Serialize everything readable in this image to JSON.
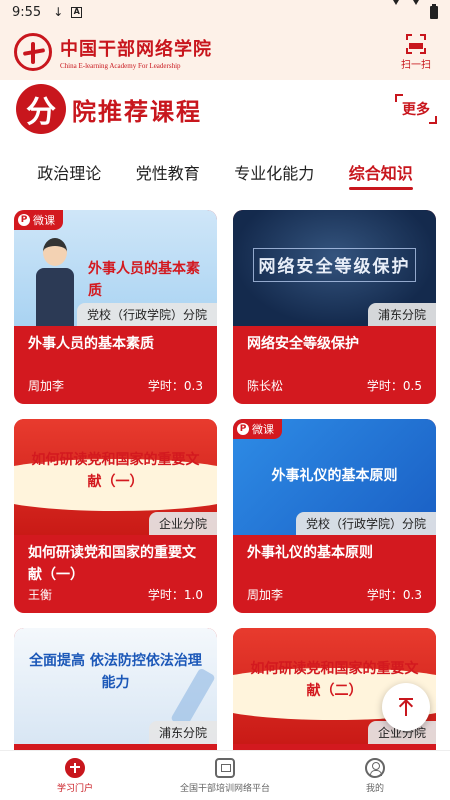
{
  "status_bar": {
    "time": "9:55"
  },
  "header": {
    "brand_name": "中国干部网络学院",
    "brand_sub": "China E-learning Academy For Leadership",
    "scan_label": "扫一扫"
  },
  "section": {
    "seal": "分",
    "title": "院推荐课程",
    "more": "更多"
  },
  "tabs": [
    {
      "label": "政治理论",
      "active": false
    },
    {
      "label": "党性教育",
      "active": false
    },
    {
      "label": "专业化能力",
      "active": false
    },
    {
      "label": "综合知识",
      "active": true
    }
  ],
  "cards": [
    {
      "thumb_text": "外事人员的基本素质",
      "badge": "微课",
      "school": "党校（行政学院）分院",
      "title": "外事人员的基本素质",
      "author": "周加李",
      "hours": "学时：0.3"
    },
    {
      "thumb_text": "网络安全等级保护",
      "badge": "",
      "school": "浦东分院",
      "title": "网络安全等级保护",
      "author": "陈长松",
      "hours": "学时：0.5"
    },
    {
      "thumb_text": "如何研读党和国家的重要文献（一）",
      "badge": "",
      "school": "企业分院",
      "title": "如何研读党和国家的重要文献（一）",
      "author": "王衡",
      "hours": "学时：1.0"
    },
    {
      "thumb_text": "外事礼仪的基本原则",
      "badge": "微课",
      "school": "党校（行政学院）分院",
      "title": "外事礼仪的基本原则",
      "author": "周加李",
      "hours": "学时：0.3"
    },
    {
      "thumb_text": "全面提高 依法防控依法治理能力",
      "badge": "",
      "school": "浦东分院",
      "title": "",
      "author": "",
      "hours": ""
    },
    {
      "thumb_text": "如何研读党和国家的重要文献（二）",
      "badge": "",
      "school": "企业分院",
      "title": "",
      "author": "",
      "hours": ""
    }
  ],
  "bottom_nav": [
    {
      "label": "学习门户",
      "icon": "portal-icon",
      "active": true
    },
    {
      "label": "全国干部培训网络平台",
      "icon": "monitor-icon",
      "active": false
    },
    {
      "label": "我的",
      "icon": "user-icon",
      "active": false
    }
  ],
  "colors": {
    "primary": "#c8161d",
    "header_bg": "#fdf1e8",
    "card_red": "#d3191f"
  }
}
